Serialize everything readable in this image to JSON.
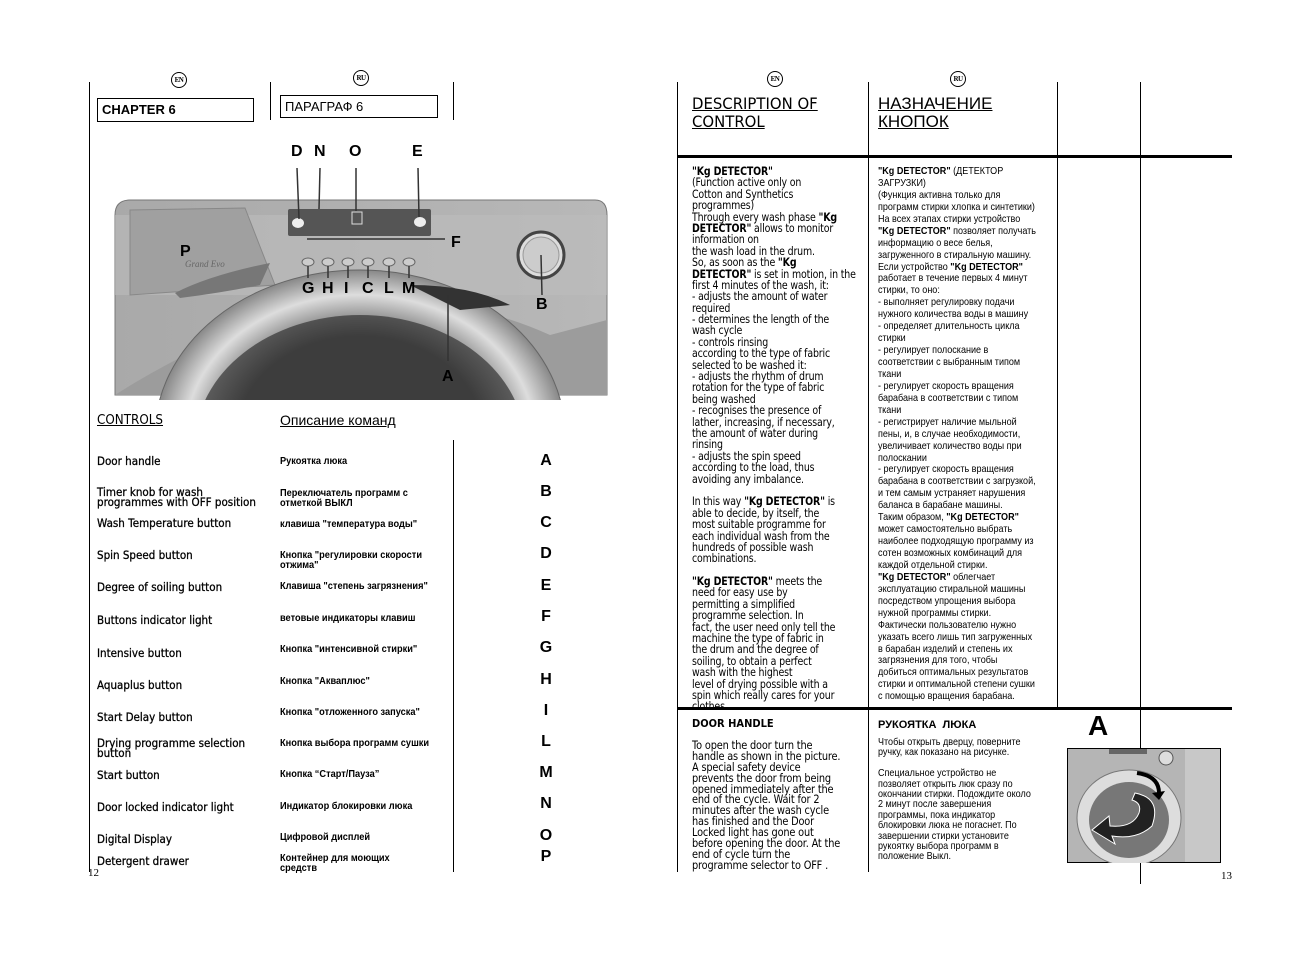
{
  "left_page": {
    "lang_en": "EN",
    "lang_ru": "RU",
    "chapter_en": "CHAPTER 6",
    "chapter_ru": "ПАРАГРАФ 6",
    "figure_labels": {
      "D": "D",
      "N": "N",
      "O": "O",
      "E": "E",
      "F": "F",
      "P": "P",
      "G": "G",
      "H": "H",
      "I": "I",
      "C": "C",
      "L": "L",
      "M": "M",
      "B": "B",
      "A": "A"
    },
    "figure_logo": "Grand Evo",
    "controls_title_en": "CONTROLS",
    "controls_title_ru": "Описание команд",
    "controls": [
      {
        "en": "Door handle",
        "ru": "Рукоятка люка",
        "key": "A"
      },
      {
        "en": "Timer knob for wash\nprogrammes with OFF position",
        "ru": "Переключатель программ с\nотметкой ВЫКЛ",
        "key": "B"
      },
      {
        "en": "Wash Temperature button",
        "ru": "клавиша \"температура воды\"",
        "key": "C"
      },
      {
        "en": "Spin Speed button",
        "ru": "Кнопка \"регулировки скорости\nотжима\"",
        "key": "D"
      },
      {
        "en": "Degree of soiling button",
        "ru": "Клавиша \"степень загрязнения\"",
        "key": "E"
      },
      {
        "en": "Buttons indicator light",
        "ru": "ветовые индикаторы клавиш",
        "key": "F"
      },
      {
        "en": "Intensive button",
        "ru": "Кнопка \"интенсивной стирки\"",
        "key": "G"
      },
      {
        "en": "Aquaplus button",
        "ru": "Кнопка \"Акваплюс\"",
        "key": "H"
      },
      {
        "en": "Start Delay button",
        "ru": "Кнопка \"отложенного запуска\"",
        "key": "I"
      },
      {
        "en": "Drying programme selection\nbutton",
        "ru": "Кнопка выбора программ сушки",
        "key": "L"
      },
      {
        "en": "Start button",
        "ru": "Кнопка “Старт/Пауза”",
        "key": "M"
      },
      {
        "en": "Door locked indicator light",
        "ru": "Индикатор блокировки люка",
        "key": "N"
      },
      {
        "en": "Digital Display",
        "ru": "Цифровой дисплей",
        "key": "O"
      },
      {
        "en": "Detergent drawer",
        "ru": "Контейнер для моющих\nсредств",
        "key": "P"
      }
    ],
    "page_number": "12"
  },
  "right_page": {
    "lang_en": "EN",
    "lang_ru": "RU",
    "title_en": [
      "DESCRIPTION OF",
      "CONTROL"
    ],
    "title_ru": [
      "НАЗНАЧЕНИЕ",
      "КНОПОК"
    ],
    "kg_en": [
      "\"Kg DETECTOR\"",
      "(Function active only on",
      "Cotton and Synthetics",
      "programmes)",
      "Through every wash phase \"Kg",
      "DETECTOR\" allows  to monitor",
      "information on",
      "the wash load in the drum.",
      "So, as soon as the \"Kg",
      "DETECTOR\" is set in motion, in the",
      "first 4 minutes of the wash, it:",
      "- adjusts the amount of water",
      "required",
      "- determines the length of the",
      "wash cycle",
      "- controls rinsing",
      "according to the type of fabric",
      "selected to be washed it:",
      "- adjusts the rhythm of drum",
      "rotation for the type of fabric",
      "being washed",
      "- recognises the presence of",
      "lather, increasing, if necessary,",
      "the amount of water during",
      "rinsing",
      "- adjusts the spin speed",
      "according to the load, thus",
      "avoiding any imbalance.",
      "",
      "In this way \"Kg DETECTOR\" is",
      "able to decide, by itself, the",
      "most suitable programme for",
      "each individual wash from the",
      "hundreds of possible wash",
      "combinations.",
      "",
      "\"Kg DETECTOR\" meets the",
      "need for easy use by",
      "permitting a simplified",
      "programme selection. In",
      "fact, the user need only tell the",
      "machine the type of fabric in",
      "the drum and the degree of",
      "soiling, to obtain a perfect",
      "wash with the highest",
      "level of drying possible with a",
      "spin which really cares for your",
      "clothes."
    ],
    "kg_ru": [
      "\"Kg DETECTOR\" (ДЕТЕКТОР",
      "ЗАГРУЗКИ)",
      "(Функция активна только для",
      "программ стирки хлопка и синтетики)",
      "На всех этапах стирки устройство",
      "\"Kg DETECTOR\" позволяет получать",
      "информацию о весе белья,",
      "загруженного в стиральную машину.",
      "Если устройство \"Kg DETECTOR\"",
      "работает в течение первых 4 минут",
      "стирки, то оно:",
      "- выполняет регулировку подачи",
      "нужного количества воды в машину",
      "- определяет длительность цикла",
      "стирки",
      "- регулирует полоскание в",
      "соответствии с выбранным типом",
      "ткани",
      "- регулирует скорость вращения",
      "барабана в соответствии с типом",
      "ткани",
      "- регистрирует наличие мыльной",
      "пены, и, в случае необходимости,",
      "увеличивает количество воды при",
      "полоскании",
      "- регулирует скорость вращения",
      "барабана в соответствии с загрузкой,",
      "и тем самым устраняет нарушения",
      "баланса в барабане машины.",
      "Таким образом, \"Kg DETECTOR\"",
      "может самостоятельно выбрать",
      "наиболее подходящую программу из",
      "сотен возможных комбинаций для",
      "каждой отдельной стирки.",
      "\"Kg DETECTOR\" облегчает",
      "эксплуатацию стиральной машины",
      "посредством упрощения выбора",
      "нужной программы стирки.",
      "Фактически пользователю нужно",
      "указать всего лишь тип загруженных",
      "в барабан изделий и степень их",
      "загрязнения для того, чтобы",
      "добиться оптимальных результатов",
      "стирки и оптимальной степени сушки",
      "с помощью вращения барабана."
    ],
    "door_en_heading": "DOOR HANDLE",
    "door_en": [
      "To open the door turn the",
      "handle as shown in the picture.",
      "A special safety device",
      "prevents the door from being",
      "opened immediately after the",
      "end of the cycle. Wait for 2",
      "minutes after the wash cycle",
      "has finished and the Door",
      "Locked light has gone out",
      "before opening the door. At the",
      "end of cycle turn the",
      "programme selector to OFF ."
    ],
    "door_ru_heading": "РУКОЯТКА  ЛЮКА",
    "door_ru": [
      "Чтобы открыть дверцу, поверните",
      "ручку, как показано на рисунке.",
      "",
      "Специальное устройство не",
      "позволяет открыть люк сразу по",
      "окончании стирки. Подождите около",
      "2 минут после завершения",
      "программы, пока индикатор",
      "блокировки люка не погаснет. По",
      "завершении стирки установите",
      "рукоятку выбора программ в",
      "положение Выкл."
    ],
    "figure_letter": "A",
    "page_number": "13"
  }
}
